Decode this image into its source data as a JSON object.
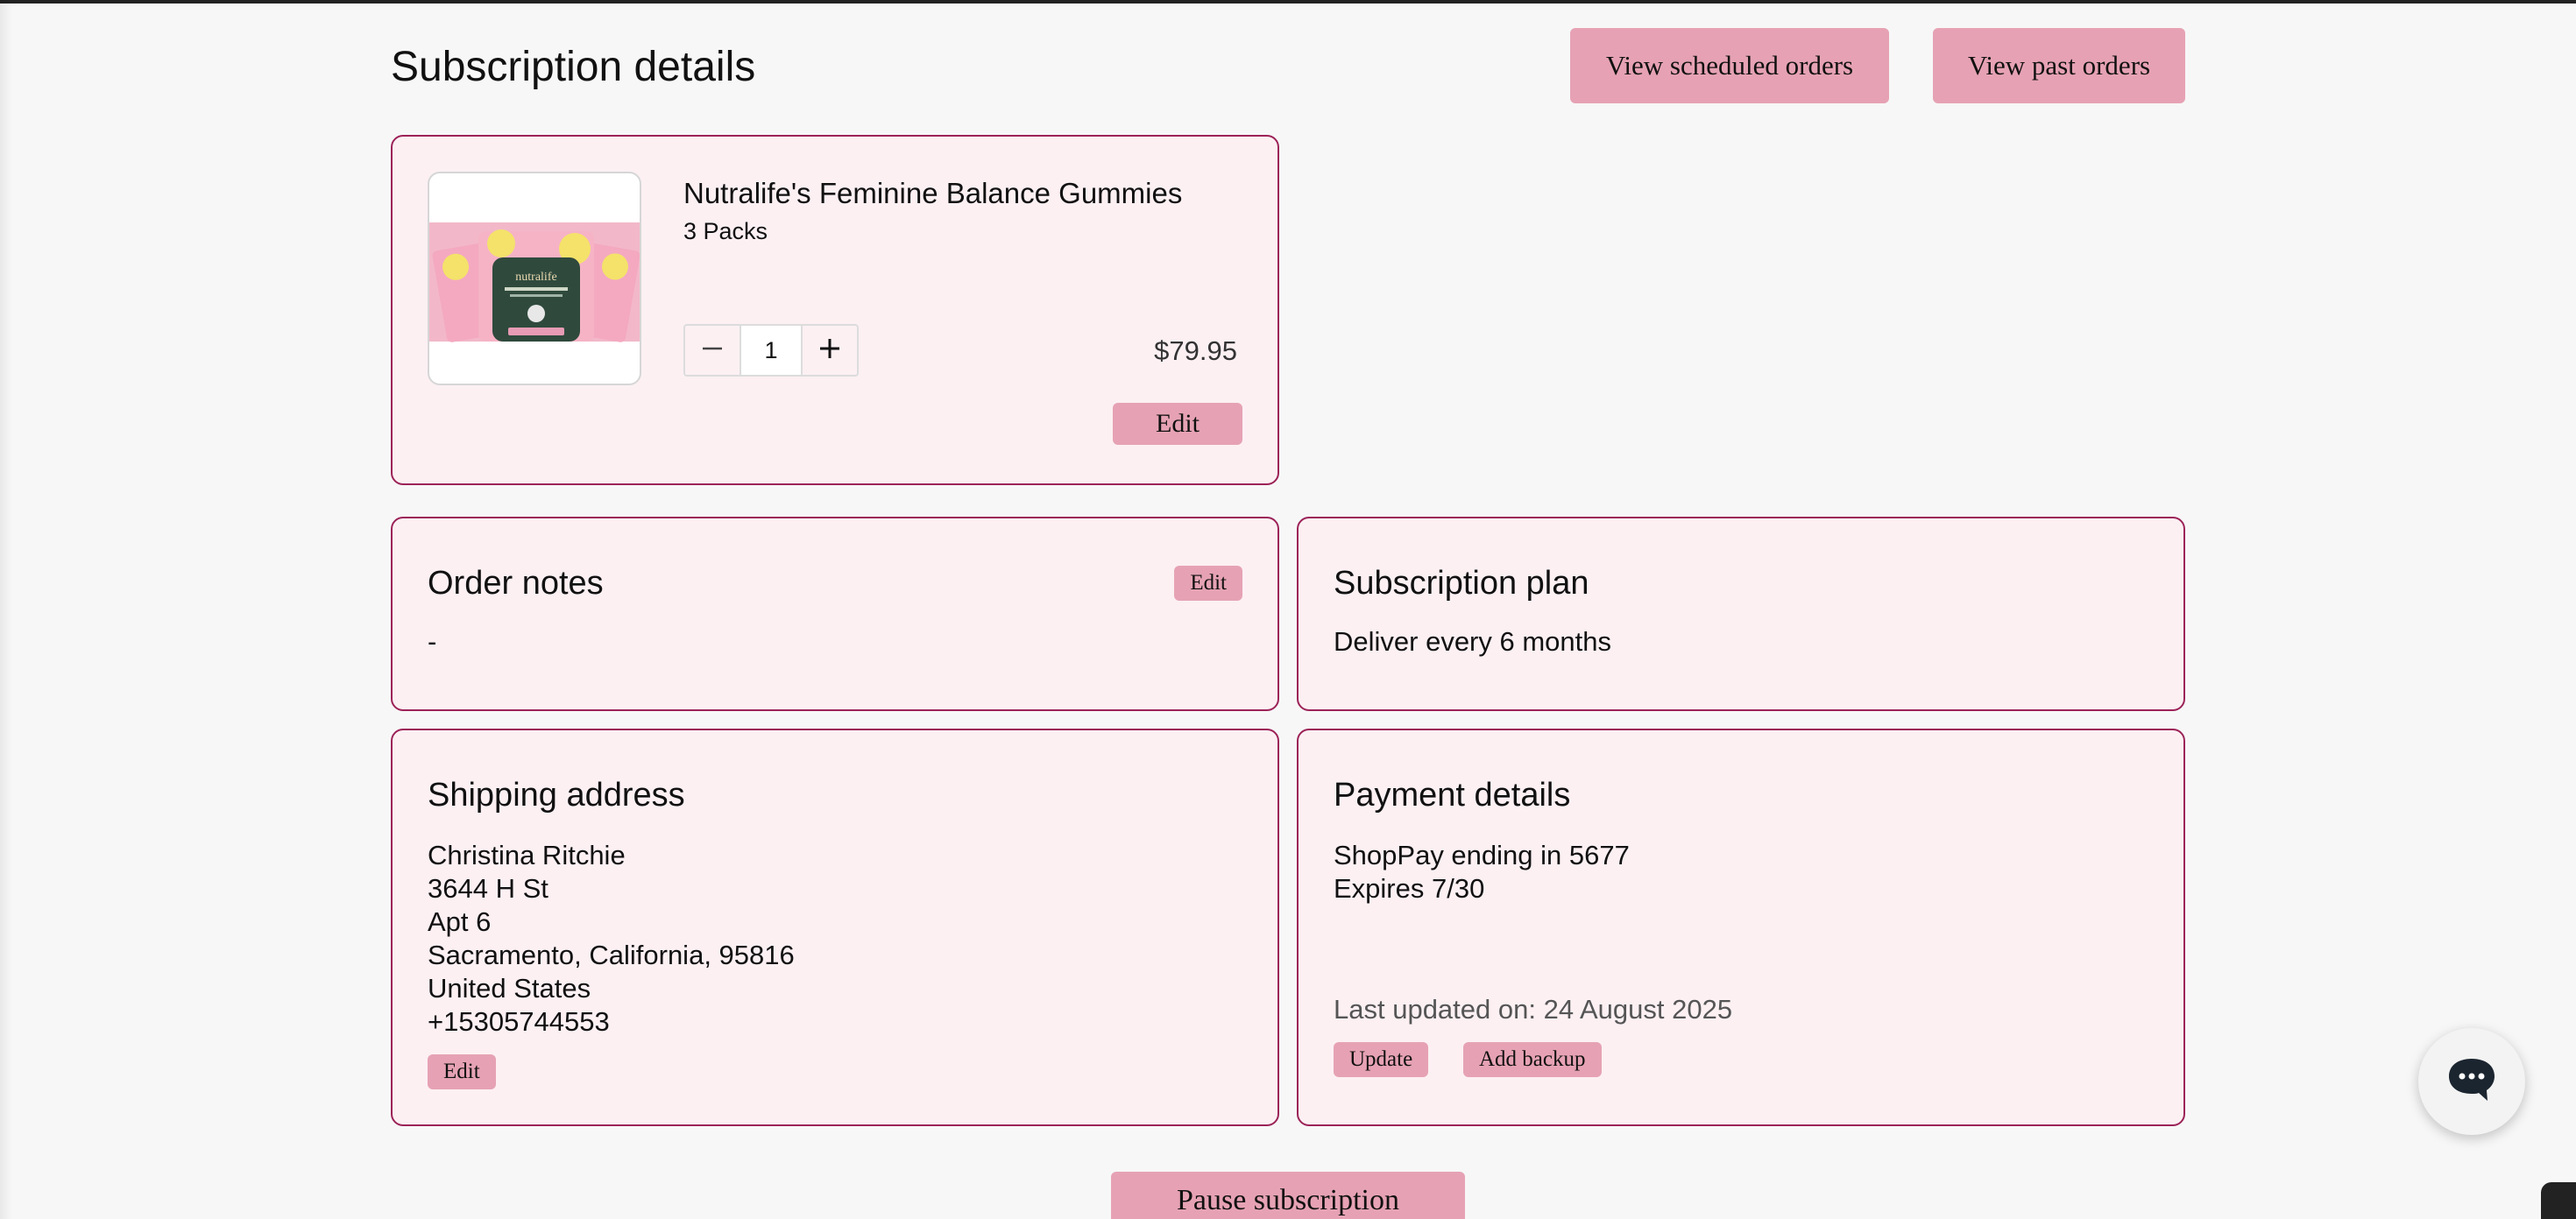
{
  "page": {
    "title": "Subscription details",
    "view_scheduled_label": "View scheduled orders",
    "view_past_label": "View past orders"
  },
  "product": {
    "name": "Nutralife's Feminine Balance Gummies",
    "variant": "3 Packs",
    "quantity": "1",
    "price": "$79.95",
    "edit_label": "Edit",
    "image_brand": "nutralife"
  },
  "order_notes": {
    "title": "Order notes",
    "value": "-",
    "edit_label": "Edit"
  },
  "plan": {
    "title": "Subscription plan",
    "value": "Deliver every 6 months"
  },
  "shipping": {
    "title": "Shipping address",
    "lines": [
      "Christina Ritchie",
      "3644 H St",
      "Apt 6",
      "Sacramento, California, 95816",
      "United States",
      "+15305744553"
    ],
    "edit_label": "Edit"
  },
  "payment": {
    "title": "Payment details",
    "method": "ShopPay ending in 5677",
    "expires": "Expires 7/30",
    "last_updated": "Last updated on: 24 August 2025",
    "update_label": "Update",
    "add_backup_label": "Add backup"
  },
  "footer": {
    "pause_label": "Pause subscription"
  },
  "icons": {
    "minus": "minus-icon",
    "plus": "plus-icon",
    "chat": "chat-bubble-icon"
  },
  "colors": {
    "accent_button": "#e6a2b4",
    "card_border": "#9c2358",
    "card_bg": "#fcf0f3"
  }
}
